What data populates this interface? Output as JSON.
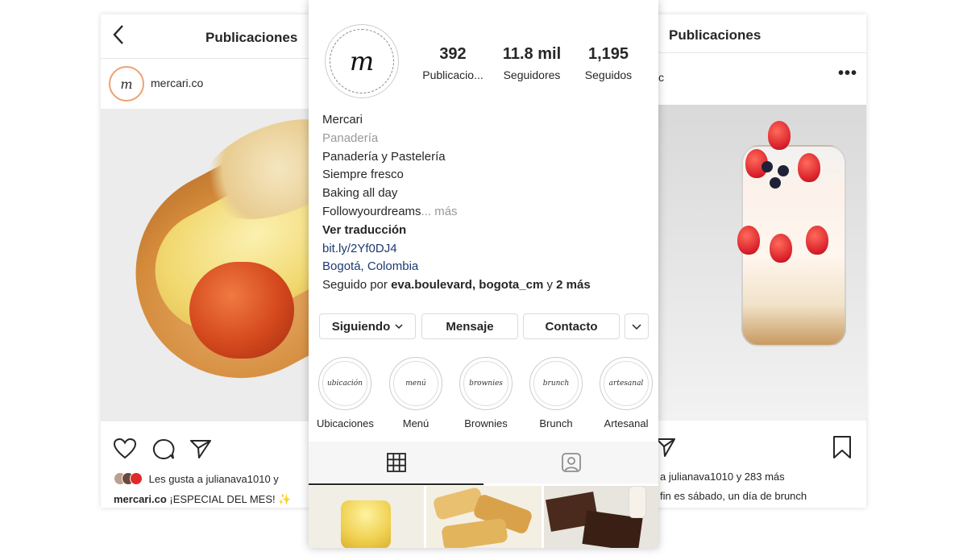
{
  "left_post": {
    "header_title": "Publicaciones",
    "username": "mercari.co",
    "avatar_letter": "m",
    "likes_text": "Les gusta a julianava1010 y",
    "caption_user": "mercari.co",
    "caption_text": "¡ESPECIAL DEL MES! ✨"
  },
  "right_post": {
    "header_title": "Publicaciones",
    "username_partial": "c",
    "more_label": "•••",
    "likes_text": "a julianava1010 y 283 más",
    "caption_text": "fin es sábado, un día de brunch"
  },
  "profile": {
    "avatar_letter": "m",
    "stats": [
      {
        "value": "392",
        "label": "Publicacio..."
      },
      {
        "value": "11.8 mil",
        "label": "Seguidores"
      },
      {
        "value": "1,195",
        "label": "Seguidos"
      }
    ],
    "name": "Mercari",
    "category": "Panadería",
    "bio_lines": [
      "Panadería y Pastelería",
      "Siempre fresco",
      "Baking all day"
    ],
    "bio_last": "Followyourdreams",
    "more_label": "... más",
    "translate_label": "Ver traducción",
    "link": "bit.ly/2Yf0DJ4",
    "location": "Bogotá, Colombia",
    "followed_prefix": "Seguido por ",
    "followed_users": "eva.boulevard, bogota_cm",
    "followed_mid": " y ",
    "followed_more": "2 más",
    "buttons": {
      "following": "Siguiendo",
      "message": "Mensaje",
      "contact": "Contacto"
    },
    "highlights": [
      {
        "cover": "ubicación",
        "label": "Ubicaciones"
      },
      {
        "cover": "menú",
        "label": "Menú"
      },
      {
        "cover": "brownies",
        "label": "Brownies"
      },
      {
        "cover": "brunch",
        "label": "Brunch"
      },
      {
        "cover": "artesanal",
        "label": "Artesanal"
      }
    ]
  }
}
